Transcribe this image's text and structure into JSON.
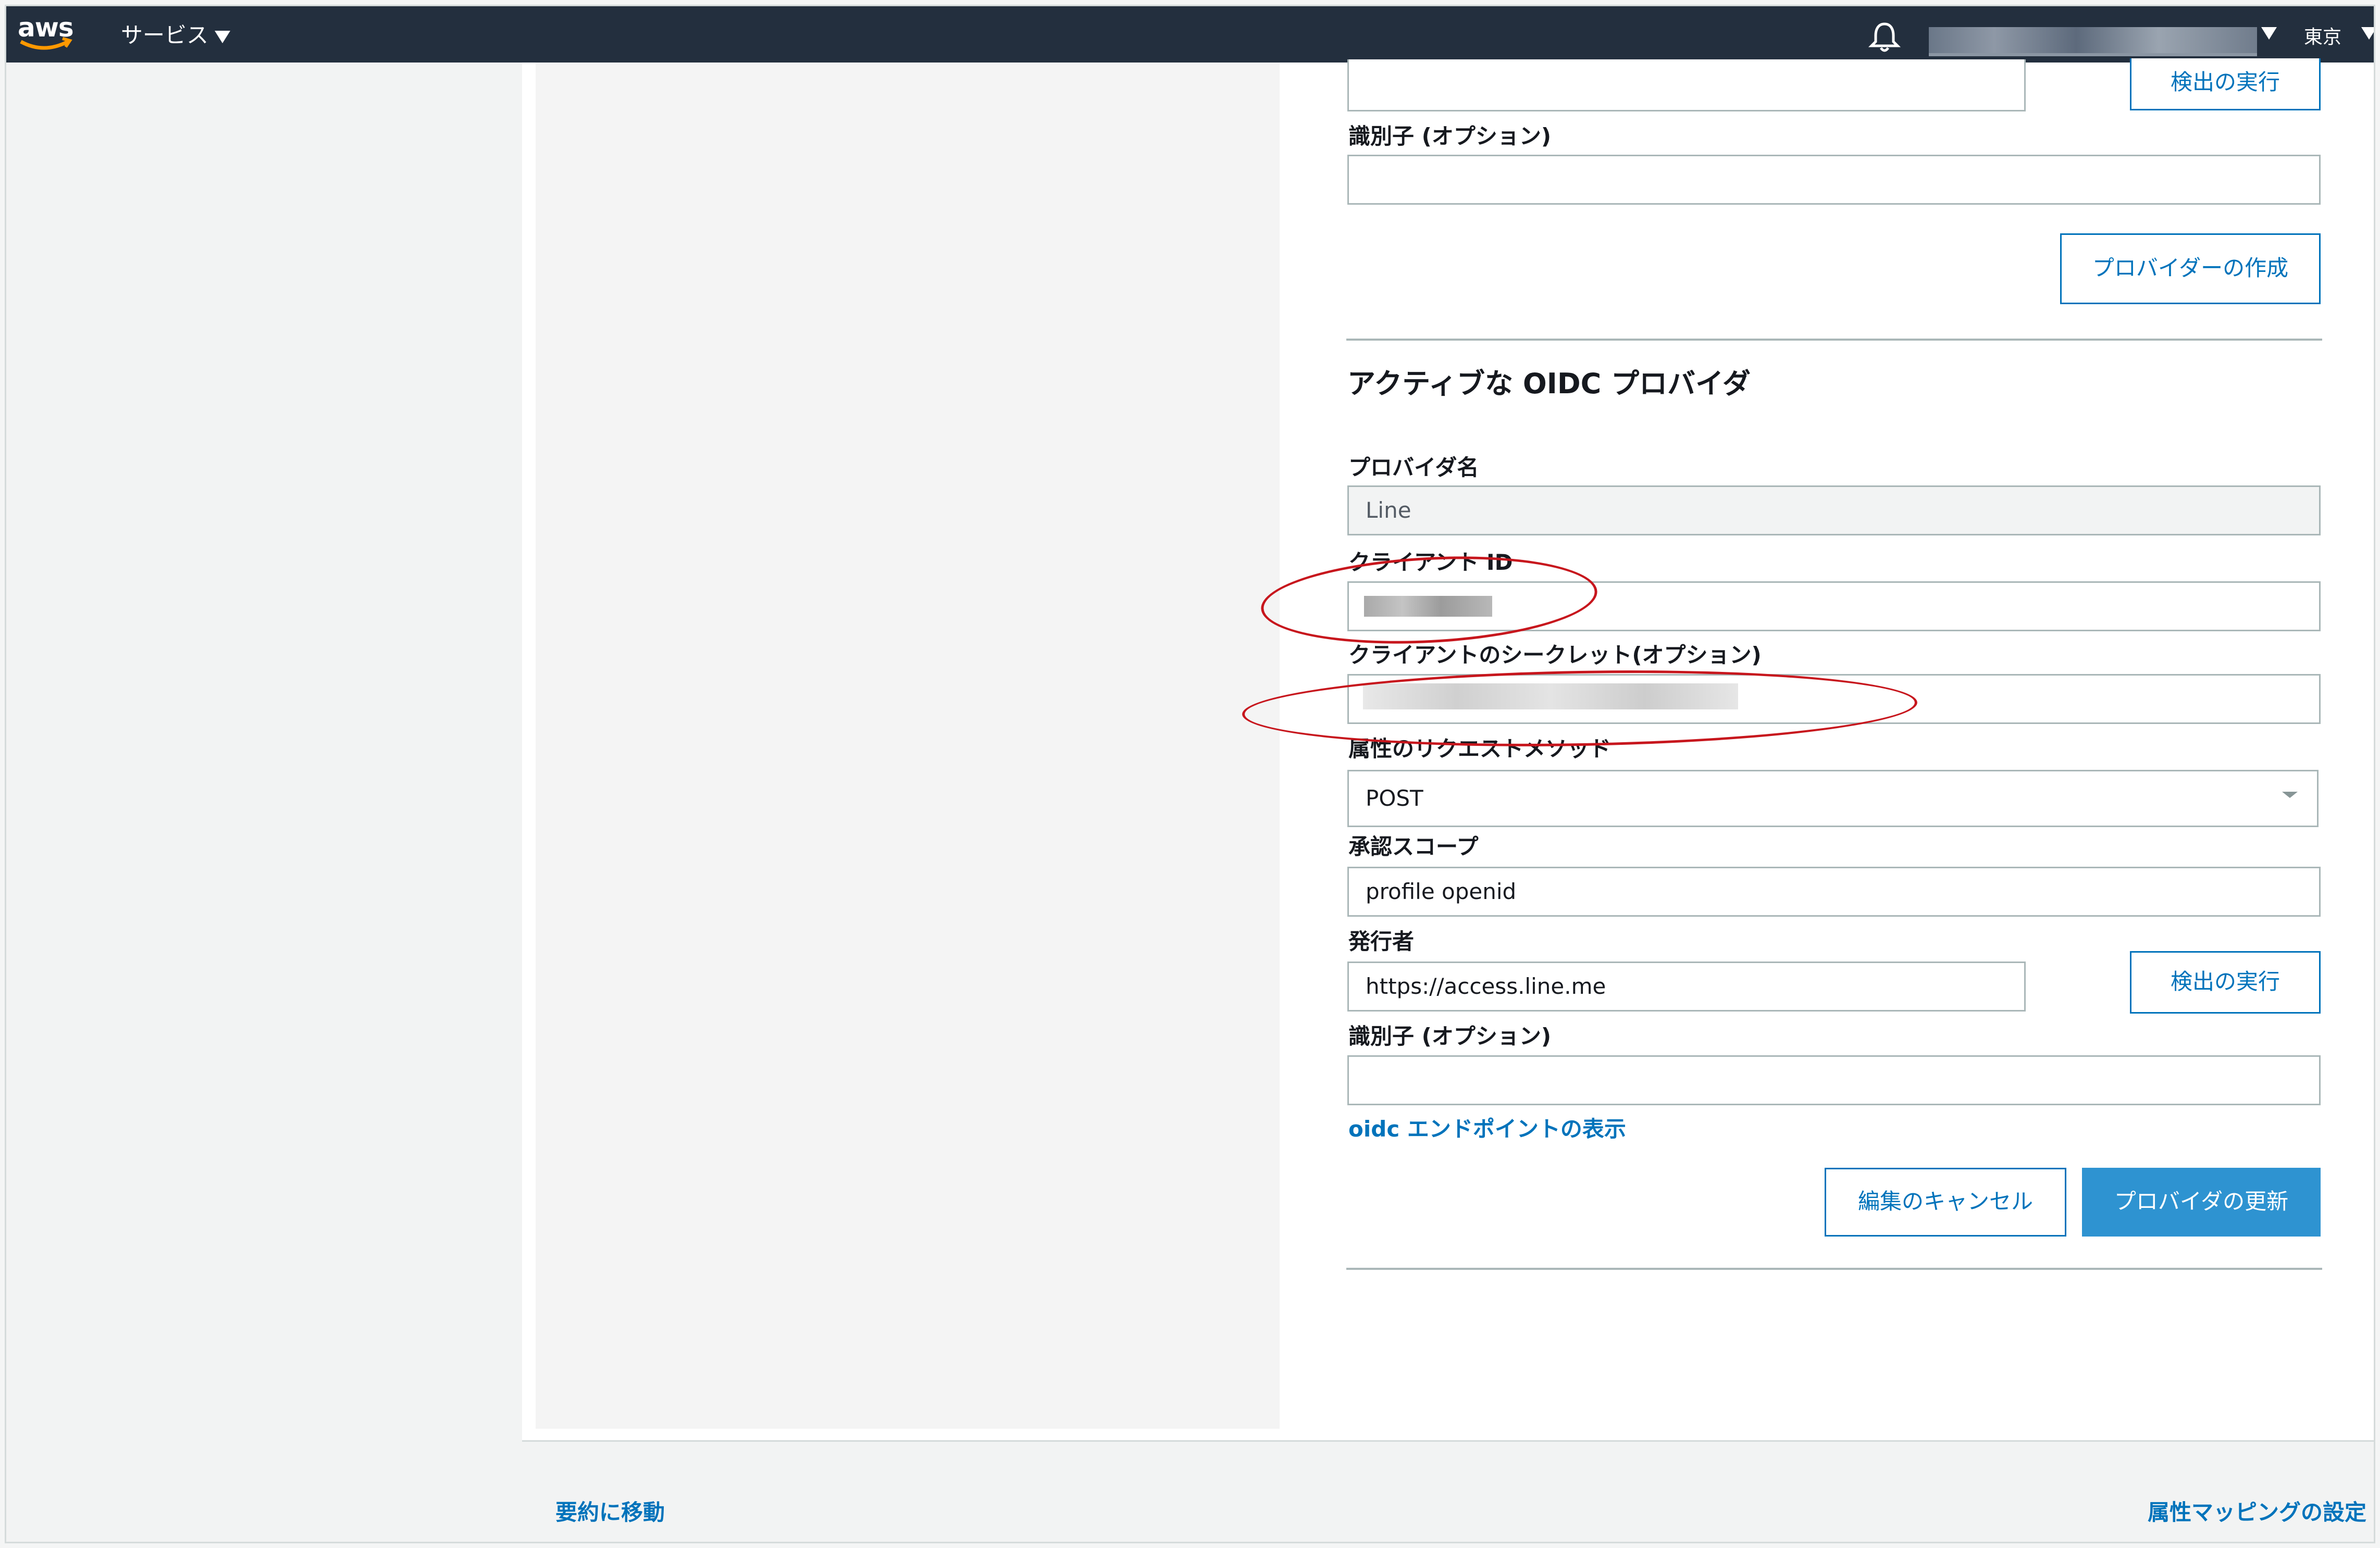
{
  "topbar": {
    "logo_text": "aws",
    "services_label": "サービス",
    "account_masked": "",
    "region_label": "東京",
    "bell_icon": "bell-icon"
  },
  "prev_provider": {
    "detect_button": "検出の実行",
    "identifier_label": "識別子 (オプション)",
    "create_button": "プロバイダーの作成"
  },
  "active_oidc": {
    "title": "アクティブな OIDC プロバイダ",
    "provider_name_label": "プロバイダ名",
    "provider_name_value": "Line",
    "client_id_label": "クライアント ID",
    "client_secret_label": "クライアントのシークレット(オプション)",
    "attr_method_label": "属性のリクエストメソッド",
    "attr_method_value": "POST",
    "scope_label": "承認スコープ",
    "scope_value": "profile openid",
    "issuer_label": "発行者",
    "issuer_value": "https://access.line.me",
    "detect_button": "検出の実行",
    "identifier_label": "識別子 (オプション)",
    "endpoints_link": "oidc エンドポイントの表示",
    "cancel_button": "編集のキャンセル",
    "update_button": "プロバイダの更新"
  },
  "footer": {
    "summary_link": "要約に移動",
    "mapping_link": "属性マッピングの設定"
  },
  "colors": {
    "nav_bg": "#232f3e",
    "link": "#0073bb",
    "primary": "#2e93d1",
    "annotation": "#c7161d"
  }
}
